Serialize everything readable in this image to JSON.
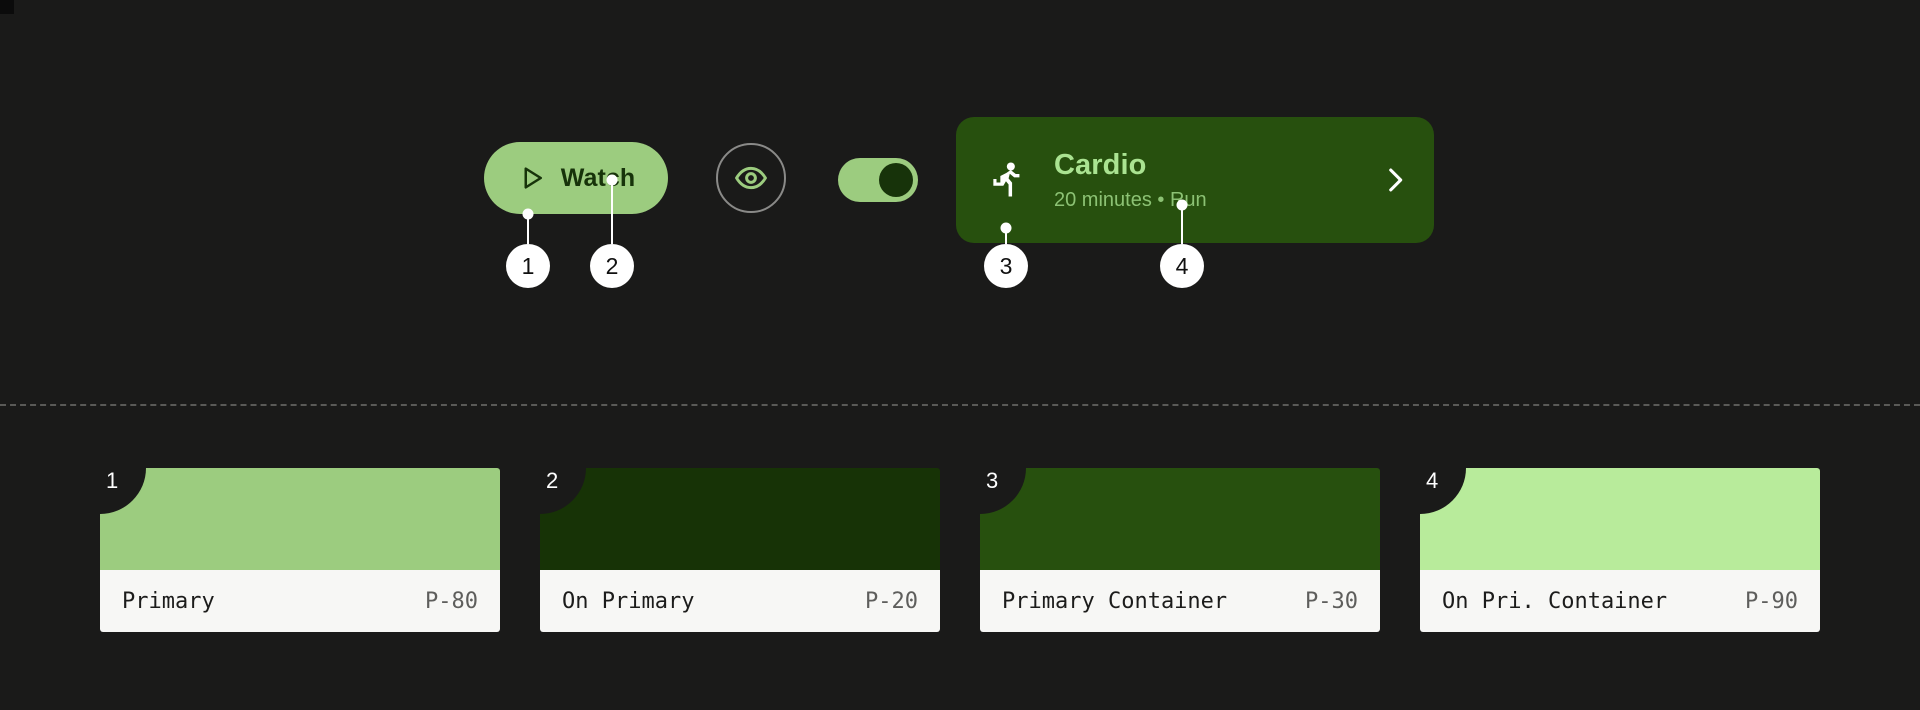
{
  "theme": {
    "background": "#1a1a19",
    "accent": "#9ccc7f",
    "card_background": "#27500e",
    "label_background": "#f7f7f5",
    "divider_color": "#5a5a57"
  },
  "components": {
    "watch_button": {
      "label": "Watch",
      "icon": "play-triangle-icon",
      "background": "#9ccc7f",
      "text_color": "#17330a"
    },
    "visibility_toggle": {
      "icon": "eye-icon",
      "icon_color": "#9ccc7f",
      "ring_color": "#8a8a88"
    },
    "switch": {
      "state": "on",
      "track_color": "#9ccc7f",
      "thumb_color": "#17330a"
    },
    "activity_card": {
      "leading_icon": "running-person-icon",
      "title": "Cardio",
      "subtitle": "20 minutes • Run",
      "trailing_icon": "chevron-right-icon",
      "background": "#27500e",
      "title_color": "#aae391",
      "subtitle_color": "#8cc274"
    }
  },
  "callouts": [
    {
      "number": "1",
      "target": "watch-button-surface"
    },
    {
      "number": "2",
      "target": "watch-button-label"
    },
    {
      "number": "3",
      "target": "activity-card-surface"
    },
    {
      "number": "4",
      "target": "activity-card-subtitle"
    }
  ],
  "swatches": [
    {
      "badge": "1",
      "name": "Primary",
      "token": "P-80",
      "color": "#9ccc7f"
    },
    {
      "badge": "2",
      "name": "On Primary",
      "token": "P-20",
      "color": "#173306"
    },
    {
      "badge": "3",
      "name": "Primary Container",
      "token": "P-30",
      "color": "#27500e"
    },
    {
      "badge": "4",
      "name": "On Pri. Container",
      "token": "P-90",
      "color": "#b8eb9b"
    }
  ]
}
